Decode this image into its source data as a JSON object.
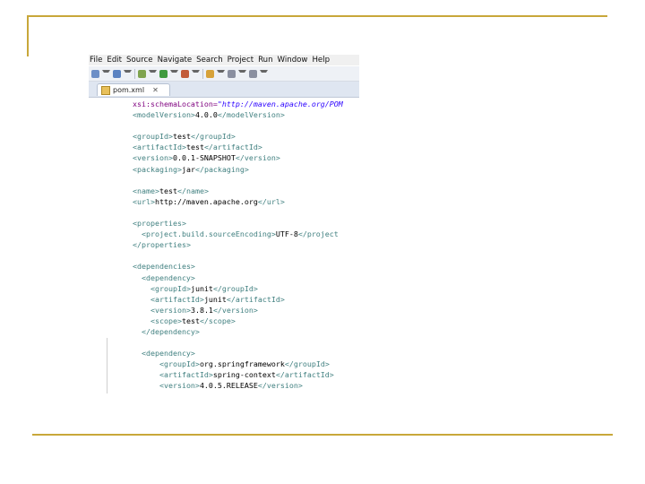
{
  "menu": [
    "File",
    "Edit",
    "Source",
    "Navigate",
    "Search",
    "Project",
    "Run",
    "Window",
    "Help"
  ],
  "toolbar_icons": [
    "new-icon",
    "save-icon",
    "debug-icon",
    "run-icon",
    "external-tools-icon",
    "search-icon",
    "back-icon",
    "forward-icon"
  ],
  "tab": {
    "title": "pom.xml",
    "close_glyph": "✕"
  },
  "code_lines": [
    [
      {
        "t": "  ",
        "c": "txt"
      },
      {
        "t": "xsi:schemaLocation=",
        "c": "attr"
      },
      {
        "t": "\"http://maven.apache.org/POM",
        "c": "val"
      }
    ],
    [
      {
        "t": "  ",
        "c": "txt"
      },
      {
        "t": "<modelVersion>",
        "c": "tag"
      },
      {
        "t": "4.0.0",
        "c": "txt"
      },
      {
        "t": "</modelVersion>",
        "c": "tag"
      }
    ],
    [],
    [
      {
        "t": "  ",
        "c": "txt"
      },
      {
        "t": "<groupId>",
        "c": "tag"
      },
      {
        "t": "test",
        "c": "txt"
      },
      {
        "t": "</groupId>",
        "c": "tag"
      }
    ],
    [
      {
        "t": "  ",
        "c": "txt"
      },
      {
        "t": "<artifactId>",
        "c": "tag"
      },
      {
        "t": "test",
        "c": "txt"
      },
      {
        "t": "</artifactId>",
        "c": "tag"
      }
    ],
    [
      {
        "t": "  ",
        "c": "txt"
      },
      {
        "t": "<version>",
        "c": "tag"
      },
      {
        "t": "0.0.1-SNAPSHOT",
        "c": "txt"
      },
      {
        "t": "</version>",
        "c": "tag"
      }
    ],
    [
      {
        "t": "  ",
        "c": "txt"
      },
      {
        "t": "<packaging>",
        "c": "tag"
      },
      {
        "t": "jar",
        "c": "txt"
      },
      {
        "t": "</packaging>",
        "c": "tag"
      }
    ],
    [],
    [
      {
        "t": "  ",
        "c": "txt"
      },
      {
        "t": "<name>",
        "c": "tag"
      },
      {
        "t": "test",
        "c": "txt"
      },
      {
        "t": "</name>",
        "c": "tag"
      }
    ],
    [
      {
        "t": "  ",
        "c": "txt"
      },
      {
        "t": "<url>",
        "c": "tag"
      },
      {
        "t": "http://maven.apache.org",
        "c": "txt"
      },
      {
        "t": "</url>",
        "c": "tag"
      }
    ],
    [],
    [
      {
        "t": "  ",
        "c": "txt"
      },
      {
        "t": "<properties>",
        "c": "tag"
      }
    ],
    [
      {
        "t": "    ",
        "c": "txt"
      },
      {
        "t": "<project.build.sourceEncoding>",
        "c": "tag"
      },
      {
        "t": "UTF-8",
        "c": "txt"
      },
      {
        "t": "</project",
        "c": "tag"
      }
    ],
    [
      {
        "t": "  ",
        "c": "txt"
      },
      {
        "t": "</properties>",
        "c": "tag"
      }
    ],
    [],
    [
      {
        "t": "  ",
        "c": "txt"
      },
      {
        "t": "<dependencies>",
        "c": "tag"
      }
    ],
    [
      {
        "t": "    ",
        "c": "txt"
      },
      {
        "t": "<dependency>",
        "c": "tag"
      }
    ],
    [
      {
        "t": "      ",
        "c": "txt"
      },
      {
        "t": "<groupId>",
        "c": "tag"
      },
      {
        "t": "junit",
        "c": "txt"
      },
      {
        "t": "</groupId>",
        "c": "tag"
      }
    ],
    [
      {
        "t": "      ",
        "c": "txt"
      },
      {
        "t": "<artifactId>",
        "c": "tag"
      },
      {
        "t": "junit",
        "c": "txt"
      },
      {
        "t": "</artifactId>",
        "c": "tag"
      }
    ],
    [
      {
        "t": "      ",
        "c": "txt"
      },
      {
        "t": "<version>",
        "c": "tag"
      },
      {
        "t": "3.8.1",
        "c": "txt"
      },
      {
        "t": "</version>",
        "c": "tag"
      }
    ],
    [
      {
        "t": "      ",
        "c": "txt"
      },
      {
        "t": "<scope>",
        "c": "tag"
      },
      {
        "t": "test",
        "c": "txt"
      },
      {
        "t": "</scope>",
        "c": "tag"
      }
    ],
    [
      {
        "t": "    ",
        "c": "txt"
      },
      {
        "t": "</dependency>",
        "c": "tag"
      }
    ],
    [],
    [
      {
        "t": "    ",
        "c": "txt"
      },
      {
        "t": "<dependency>",
        "c": "tag"
      }
    ],
    [
      {
        "t": "        ",
        "c": "txt"
      },
      {
        "t": "<groupId>",
        "c": "tag"
      },
      {
        "t": "org.springframework",
        "c": "txt"
      },
      {
        "t": "</groupId>",
        "c": "tag"
      }
    ],
    [
      {
        "t": "        ",
        "c": "txt"
      },
      {
        "t": "<artifactId>",
        "c": "tag"
      },
      {
        "t": "spring-context",
        "c": "txt"
      },
      {
        "t": "</artifactId>",
        "c": "tag"
      }
    ],
    [
      {
        "t": "        ",
        "c": "txt"
      },
      {
        "t": "<version>",
        "c": "tag"
      },
      {
        "t": "4.0.5.RELEASE",
        "c": "txt"
      },
      {
        "t": "</version>",
        "c": "tag"
      }
    ]
  ],
  "colors": {
    "slide_accent": "#c8a73a",
    "xml_tag": "#3f7f7f",
    "xml_attr": "#7f007f",
    "xml_value": "#2a00ff"
  }
}
